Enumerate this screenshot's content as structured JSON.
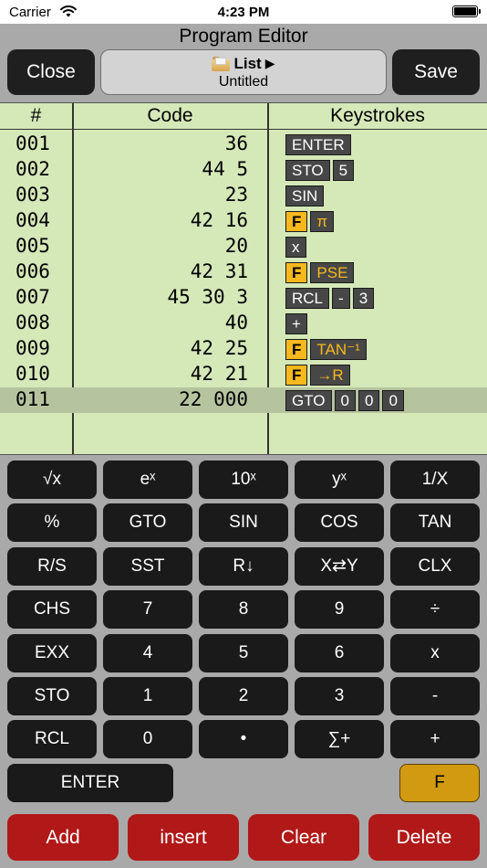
{
  "status": {
    "carrier": "Carrier",
    "time": "4:23 PM"
  },
  "header": {
    "title": "Program Editor",
    "close": "Close",
    "save": "Save",
    "list_label": "List",
    "program_name": "Untitled"
  },
  "table": {
    "headers": [
      "#",
      "Code",
      "Keystrokes"
    ],
    "rows": [
      {
        "num": "001",
        "code": "36",
        "keys": [
          {
            "label": "ENTER",
            "kind": "normal"
          }
        ]
      },
      {
        "num": "002",
        "code": "44 5",
        "keys": [
          {
            "label": "STO",
            "kind": "normal"
          },
          {
            "label": "5",
            "kind": "normal"
          }
        ]
      },
      {
        "num": "003",
        "code": "23",
        "keys": [
          {
            "label": "SIN",
            "kind": "normal"
          }
        ]
      },
      {
        "num": "004",
        "code": "42 16",
        "keys": [
          {
            "label": "F",
            "kind": "f"
          },
          {
            "label": "π",
            "kind": "fn"
          }
        ]
      },
      {
        "num": "005",
        "code": "20",
        "keys": [
          {
            "label": "x",
            "kind": "normal"
          }
        ]
      },
      {
        "num": "006",
        "code": "42 31",
        "keys": [
          {
            "label": "F",
            "kind": "f"
          },
          {
            "label": "PSE",
            "kind": "fn"
          }
        ]
      },
      {
        "num": "007",
        "code": "45 30 3",
        "keys": [
          {
            "label": "RCL",
            "kind": "normal"
          },
          {
            "label": "-",
            "kind": "normal"
          },
          {
            "label": "3",
            "kind": "normal"
          }
        ]
      },
      {
        "num": "008",
        "code": "40",
        "keys": [
          {
            "label": "+",
            "kind": "normal"
          }
        ]
      },
      {
        "num": "009",
        "code": "42 25",
        "keys": [
          {
            "label": "F",
            "kind": "f"
          },
          {
            "label": "TAN⁻¹",
            "kind": "fn"
          }
        ]
      },
      {
        "num": "010",
        "code": "42 21",
        "keys": [
          {
            "label": "F",
            "kind": "f"
          },
          {
            "label": "→R",
            "kind": "fn"
          }
        ]
      },
      {
        "num": "011",
        "code": "22 000",
        "keys": [
          {
            "label": "GTO",
            "kind": "normal"
          },
          {
            "label": "0",
            "kind": "normal"
          },
          {
            "label": "0",
            "kind": "normal"
          },
          {
            "label": "0",
            "kind": "normal"
          }
        ],
        "selected": true
      }
    ]
  },
  "keypad": {
    "rows": [
      [
        "√x",
        "eˣ",
        "10ˣ",
        "yˣ",
        "1/X"
      ],
      [
        "%",
        "GTO",
        "SIN",
        "COS",
        "TAN"
      ],
      [
        "R/S",
        "SST",
        "R↓",
        "X⇄Y",
        "CLX"
      ],
      [
        "CHS",
        "7",
        "8",
        "9",
        "÷"
      ],
      [
        "EXX",
        "4",
        "5",
        "6",
        "x"
      ],
      [
        "STO",
        "1",
        "2",
        "3",
        "-"
      ],
      [
        "RCL",
        "0",
        "•",
        "∑+",
        "+"
      ]
    ],
    "enter": "ENTER",
    "f": "F"
  },
  "actions": [
    "Add",
    "insert",
    "Clear",
    "Delete"
  ],
  "colors": {
    "accent_f": "#f7b81e",
    "delete_red": "#b11818",
    "program_bg": "#d5e8b8"
  }
}
